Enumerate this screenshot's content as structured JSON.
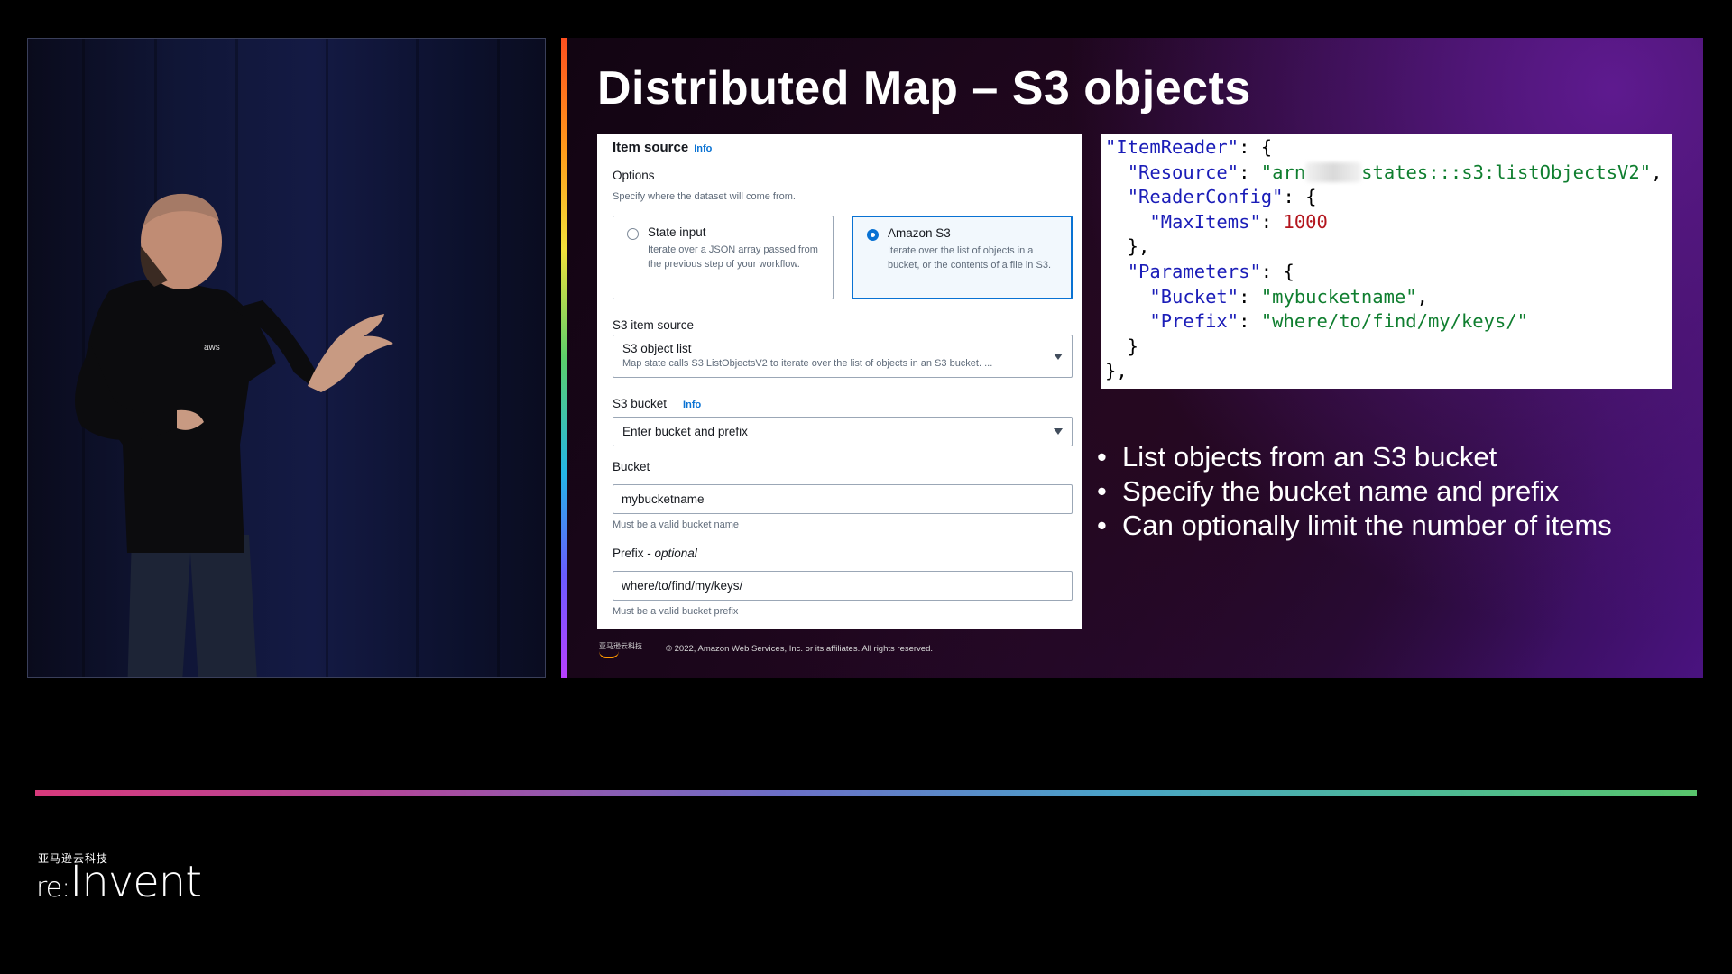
{
  "slide": {
    "title": "Distributed Map – S3 objects",
    "footer": {
      "logo_text": "亚马逊云科技",
      "copyright": "© 2022, Amazon Web Services, Inc. or its affiliates. All rights reserved."
    }
  },
  "form": {
    "item_source_label": "Item source",
    "info_link": "Info",
    "options_label": "Options",
    "options_desc": "Specify where the dataset will come from.",
    "tiles": [
      {
        "title": "State input",
        "desc": "Iterate over a JSON array passed from the previous step of your workflow.",
        "selected": false
      },
      {
        "title": "Amazon S3",
        "desc": "Iterate over the list of objects in a bucket, or the contents of a file in S3.",
        "selected": true
      }
    ],
    "s3_item_source_label": "S3 item source",
    "s3_item_source_value": "S3 object list",
    "s3_item_source_desc": "Map state calls S3 ListObjectsV2 to iterate over the list of objects in an S3 bucket. ...",
    "s3_bucket_label": "S3 bucket",
    "s3_bucket_info": "Info",
    "s3_bucket_value": "Enter bucket and prefix",
    "bucket_label": "Bucket",
    "bucket_value": "mybucketname",
    "bucket_hint": "Must be a valid bucket name",
    "prefix_label": "Prefix - ",
    "prefix_optional": "optional",
    "prefix_value": "where/to/find/my/keys/",
    "prefix_hint": "Must be a valid bucket prefix"
  },
  "code": {
    "item_reader_key": "\"ItemReader\"",
    "resource_key": "\"Resource\"",
    "resource_value_start": "\"arn",
    "resource_value_end": "states:::s3:listObjectsV2\"",
    "reader_config_key": "\"ReaderConfig\"",
    "max_items_key": "\"MaxItems\"",
    "max_items_value": "1000",
    "parameters_key": "\"Parameters\"",
    "bucket_key": "\"Bucket\"",
    "bucket_value": "\"mybucketname\"",
    "prefix_key": "\"Prefix\"",
    "prefix_value": "\"where/to/find/my/keys/\""
  },
  "bullets": [
    "List objects from an S3 bucket",
    "Specify the bucket name and prefix",
    "Can optionally limit the number of items"
  ],
  "event": {
    "cn_brand": "亚马逊云科技",
    "logo_re": "re:",
    "logo_invent": "Invent"
  },
  "colors": {
    "info_link": "#0972d3",
    "code_key": "#1b1db8",
    "code_string": "#0f7e2f",
    "code_number": "#b3151d"
  }
}
